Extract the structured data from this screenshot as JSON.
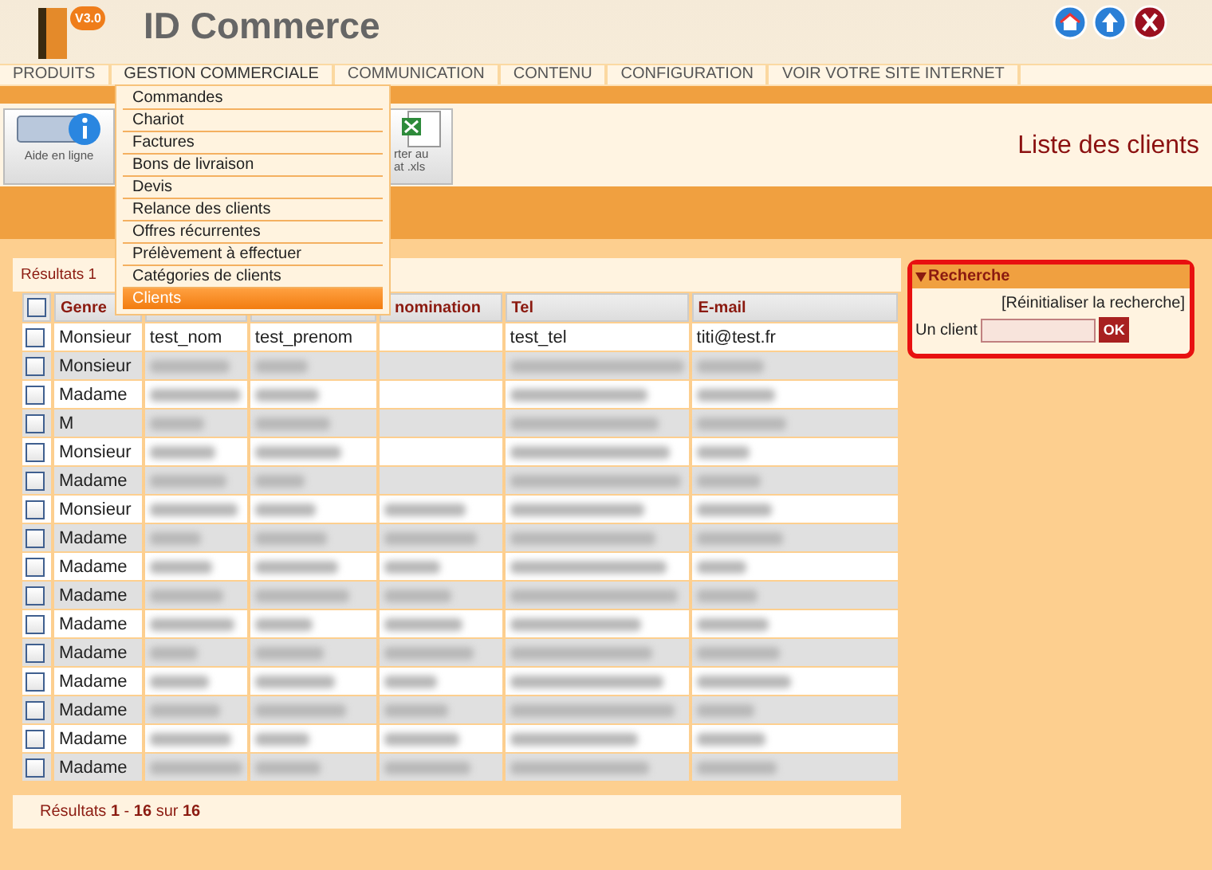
{
  "header": {
    "logo_badge": "V3.0",
    "logo_text": "ID Commerce"
  },
  "nav": [
    {
      "label": "PRODUITS",
      "selected": false
    },
    {
      "label": "GESTION COMMERCIALE",
      "selected": true
    },
    {
      "label": "COMMUNICATION",
      "selected": false
    },
    {
      "label": "CONTENU",
      "selected": false
    },
    {
      "label": "CONFIGURATION",
      "selected": false
    },
    {
      "label": "VOIR VOTRE SITE INTERNET",
      "selected": false
    }
  ],
  "menu": [
    {
      "label": "Commandes",
      "selected": false
    },
    {
      "label": "Chariot",
      "selected": false
    },
    {
      "label": "Factures",
      "selected": false
    },
    {
      "label": "Bons de livraison",
      "selected": false
    },
    {
      "label": "Devis",
      "selected": false
    },
    {
      "label": "Relance des clients",
      "selected": false
    },
    {
      "label": "Offres récurrentes",
      "selected": false
    },
    {
      "label": "Prélèvement à effectuer",
      "selected": false
    },
    {
      "label": "Catégories de clients",
      "selected": false
    },
    {
      "label": "Clients",
      "selected": true
    }
  ],
  "toolbar": [
    {
      "label": "Aide en ligne",
      "kind": "info"
    },
    {
      "lines": [
        "rter au",
        "at .xls"
      ],
      "kind": "excel"
    }
  ],
  "page_title": "Liste des clients",
  "results_top": "Résultats 1",
  "table": {
    "select_all_checked": false,
    "columns": [
      "Genre",
      "",
      "",
      "nomination",
      "Tel",
      "E-mail"
    ],
    "rows": [
      {
        "checked": false,
        "genre": "Monsieur",
        "cells": [
          "test_nom",
          "test_prenom",
          "",
          "test_tel",
          "titi@test.fr"
        ]
      },
      {
        "checked": false,
        "genre": "Monsieur"
      },
      {
        "checked": false,
        "genre": "Madame"
      },
      {
        "checked": false,
        "genre": "M"
      },
      {
        "checked": false,
        "genre": "Monsieur"
      },
      {
        "checked": false,
        "genre": "Madame"
      },
      {
        "checked": false,
        "genre": "Monsieur"
      },
      {
        "checked": false,
        "genre": "Madame"
      },
      {
        "checked": false,
        "genre": "Madame"
      },
      {
        "checked": false,
        "genre": "Madame"
      },
      {
        "checked": false,
        "genre": "Madame"
      },
      {
        "checked": false,
        "genre": "Madame"
      },
      {
        "checked": false,
        "genre": "Madame"
      },
      {
        "checked": false,
        "genre": "Madame"
      },
      {
        "checked": false,
        "genre": "Madame"
      },
      {
        "checked": false,
        "genre": "Madame"
      }
    ]
  },
  "results_bottom": "Résultats **1** - **16** sur **16**",
  "search": {
    "title": "Recherche",
    "reset_link": "[Réinitialiser la recherche]",
    "label": "Un client",
    "button": "OK"
  }
}
